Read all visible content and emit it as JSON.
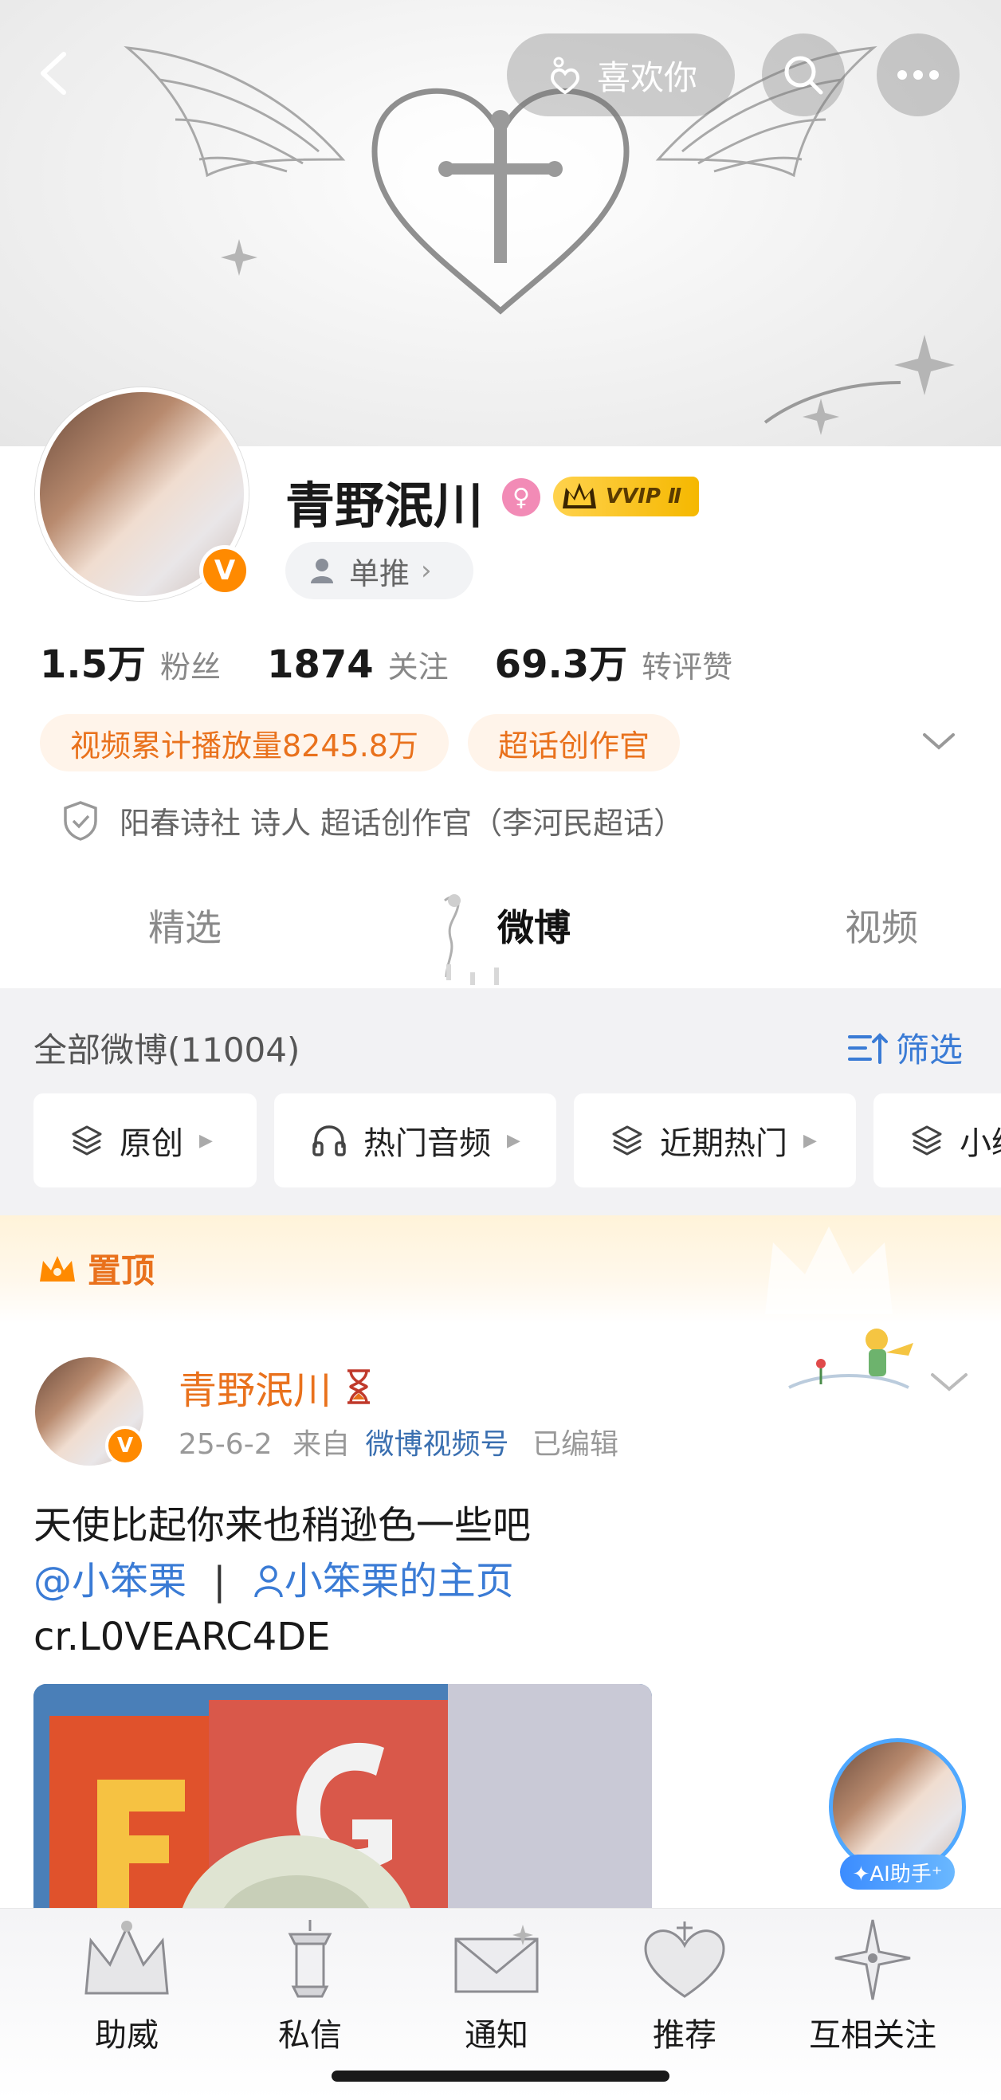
{
  "header": {
    "like_label": "喜欢你",
    "icons": [
      "back-icon",
      "heart-hand-icon",
      "search-icon",
      "more-icon"
    ]
  },
  "profile": {
    "name": "青野泯川",
    "verified_badge": "V",
    "gender_symbol": "♀",
    "vip_label": "VVIP Ⅱ",
    "single_push_label": "单推",
    "stats": [
      {
        "value": "1.5万",
        "label": "粉丝"
      },
      {
        "value": "1874",
        "label": "关注"
      },
      {
        "value": "69.3万",
        "label": "转评赞"
      }
    ],
    "tags": [
      "视频累计播放量8245.8万",
      "超话创作官"
    ],
    "verification": "阳春诗社 诗人 超话创作官（李河民超话）"
  },
  "tabs": [
    {
      "label": "精选",
      "active": false
    },
    {
      "label": "微博",
      "active": true
    },
    {
      "label": "视频",
      "active": false
    }
  ],
  "filter": {
    "all_count": "全部微博(11004)",
    "filter_label": "筛选",
    "chips": [
      "原创",
      "热门音频",
      "近期热门",
      "小编"
    ]
  },
  "pinned": {
    "label": "置顶"
  },
  "post": {
    "author": "青野泯川",
    "date": "25-6-2",
    "source_prefix": "来自",
    "source": "微博视频号",
    "edited": "已编辑",
    "line1": "天使比起你来也稍逊色一些吧",
    "mention": "@小笨栗",
    "separator": "|",
    "homepage_link": "小笨栗的主页",
    "line3": "cr.L0VEARC4DE",
    "image_text": "F G"
  },
  "ai_helper": {
    "label": "✦AI助手⁺"
  },
  "bottom_nav": [
    {
      "label": "助威",
      "icon": "crown-icon"
    },
    {
      "label": "私信",
      "icon": "lantern-icon"
    },
    {
      "label": "通知",
      "icon": "envelope-icon"
    },
    {
      "label": "推荐",
      "icon": "heart-locket-icon"
    },
    {
      "label": "互相关注",
      "icon": "star-icon"
    }
  ],
  "colors": {
    "accent_orange": "#e9711c",
    "link_blue": "#3a7bd5",
    "verified_orange": "#ff8a00"
  }
}
